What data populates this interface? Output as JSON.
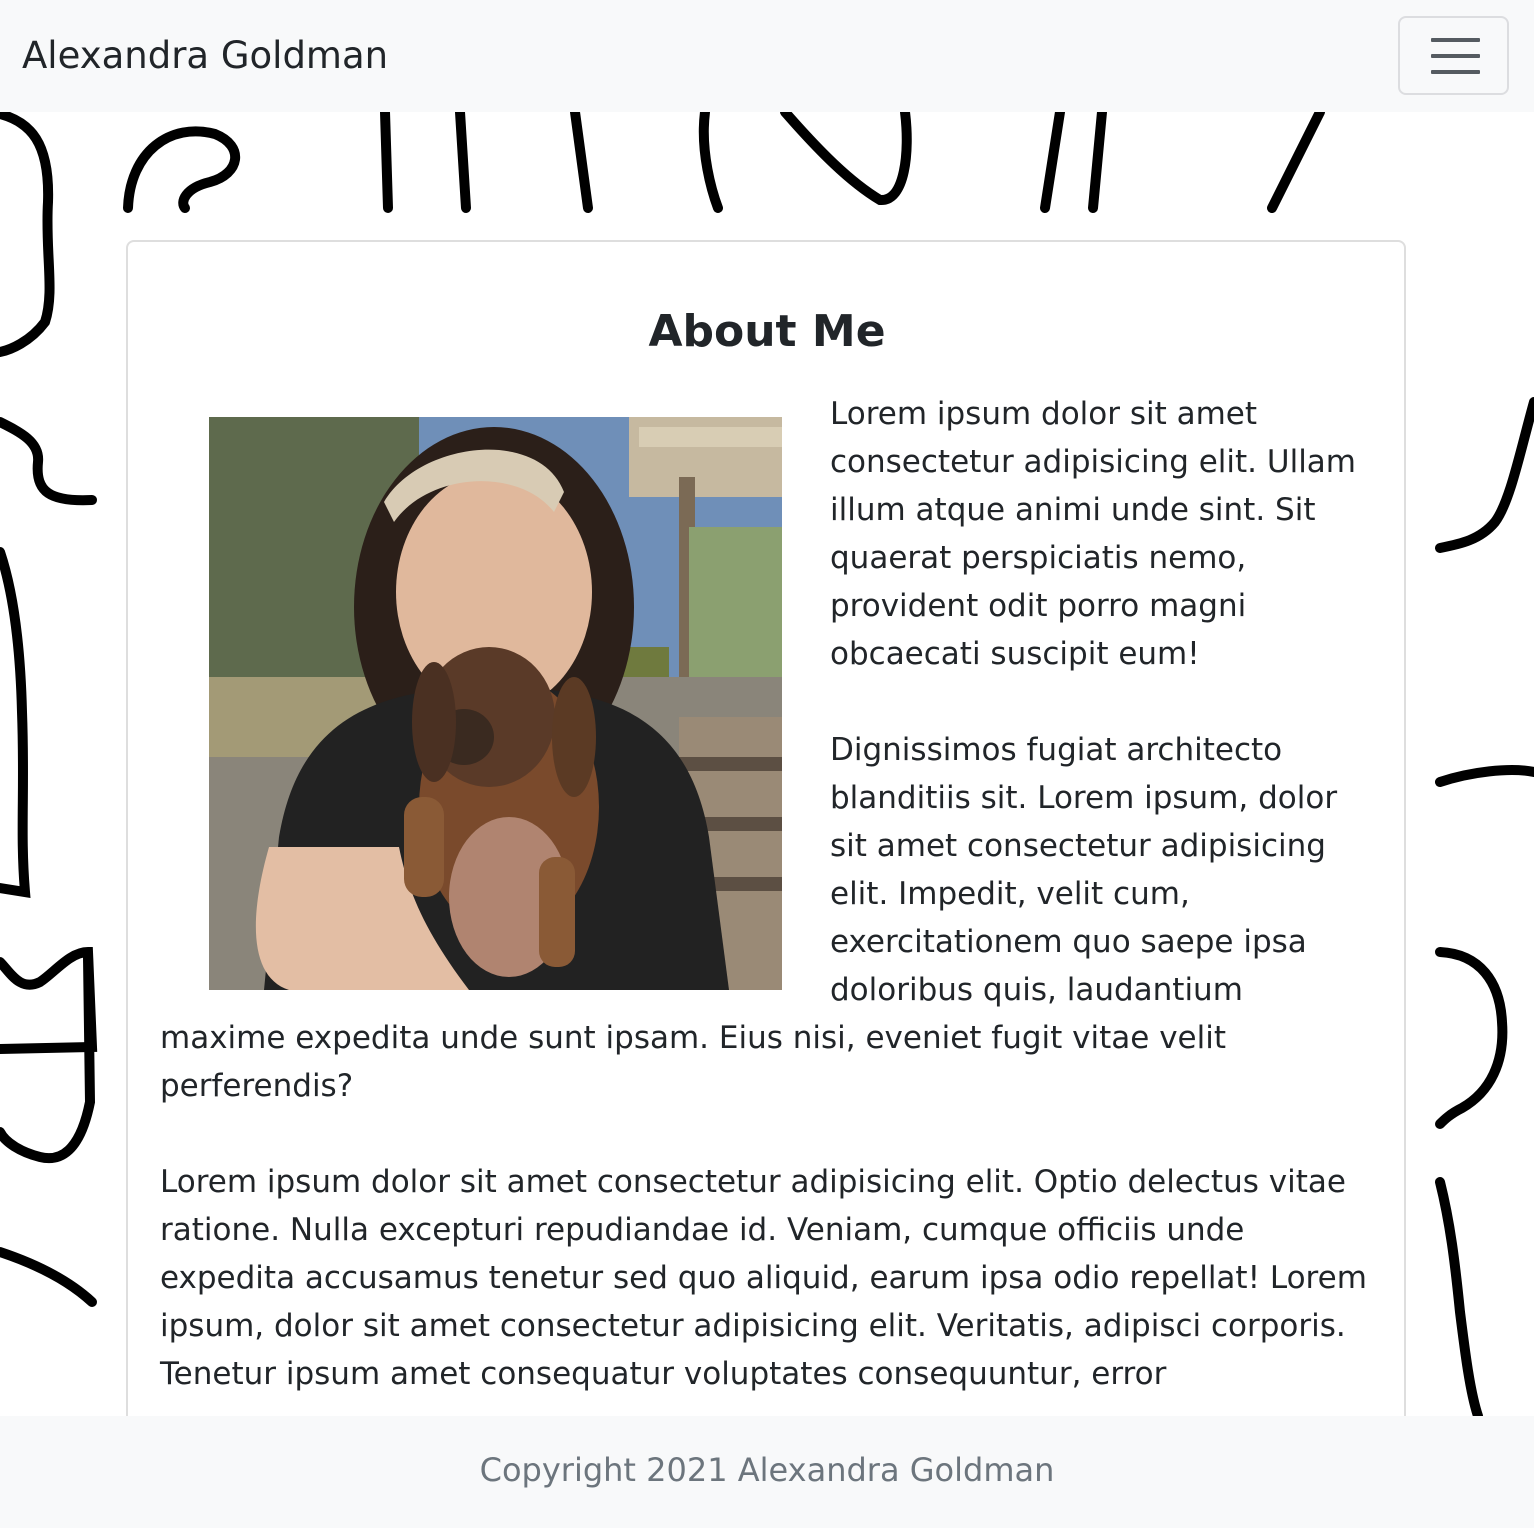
{
  "navbar": {
    "brand": "Alexandra Goldman"
  },
  "about": {
    "title": "About Me",
    "photo_alt": "Woman smiling and hugging a dachshund puppy",
    "paragraphs": [
      "Lorem ipsum dolor sit amet consectetur adipisicing elit. Ullam illum atque animi unde sint. Sit quaerat perspiciatis nemo, provident odit porro magni obcaecati suscipit eum!",
      "Dignissimos fugiat architecto blanditiis sit. Lorem ipsum, dolor sit amet consectetur adipisicing elit. Impedit, velit cum, exercitationem quo saepe ipsa doloribus quis, laudantium maxime expedita unde sunt ipsam. Eius nisi, eveniet fugit vitae velit perferendis?",
      "Lorem ipsum dolor sit amet consectetur adipisicing elit. Optio delectus vitae ratione. Nulla excepturi repudiandae id. Veniam, cumque officiis unde expedita accusamus tenetur sed quo aliquid, earum ipsa odio repellat! Lorem ipsum, dolor sit amet consectetur adipisicing elit. Veritatis, adipisci corporis. Tenetur ipsum amet consequatur voluptates consequuntur, error"
    ]
  },
  "footer": {
    "copyright": "Copyright 2021 Alexandra Goldman"
  },
  "colors": {
    "navbar_bg": "#f8f9fa",
    "text": "#212529",
    "muted": "#6c757d",
    "card_border": "#dedede"
  },
  "icons": {
    "toggler": "hamburger-menu-icon"
  }
}
